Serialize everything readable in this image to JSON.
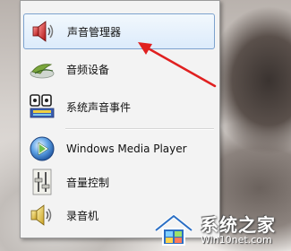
{
  "menu": {
    "items": [
      {
        "label": "声音管理器",
        "icon": "speaker-icon",
        "selected": true
      },
      {
        "label": "音频设备",
        "icon": "audio-device-icon",
        "selected": false
      },
      {
        "label": "系统声音事件",
        "icon": "system-sounds-icon",
        "selected": false
      },
      {
        "label": "Windows Media Player",
        "icon": "media-player-icon",
        "selected": false
      },
      {
        "label": "音量控制",
        "icon": "volume-control-icon",
        "selected": false
      },
      {
        "label": "录音机",
        "icon": "sound-recorder-icon",
        "selected": false
      }
    ]
  },
  "watermark": {
    "title": "系统之家",
    "url": "Win10net.com"
  },
  "colors": {
    "selection_border": "#7da2ce",
    "arrow": "#e02020"
  }
}
